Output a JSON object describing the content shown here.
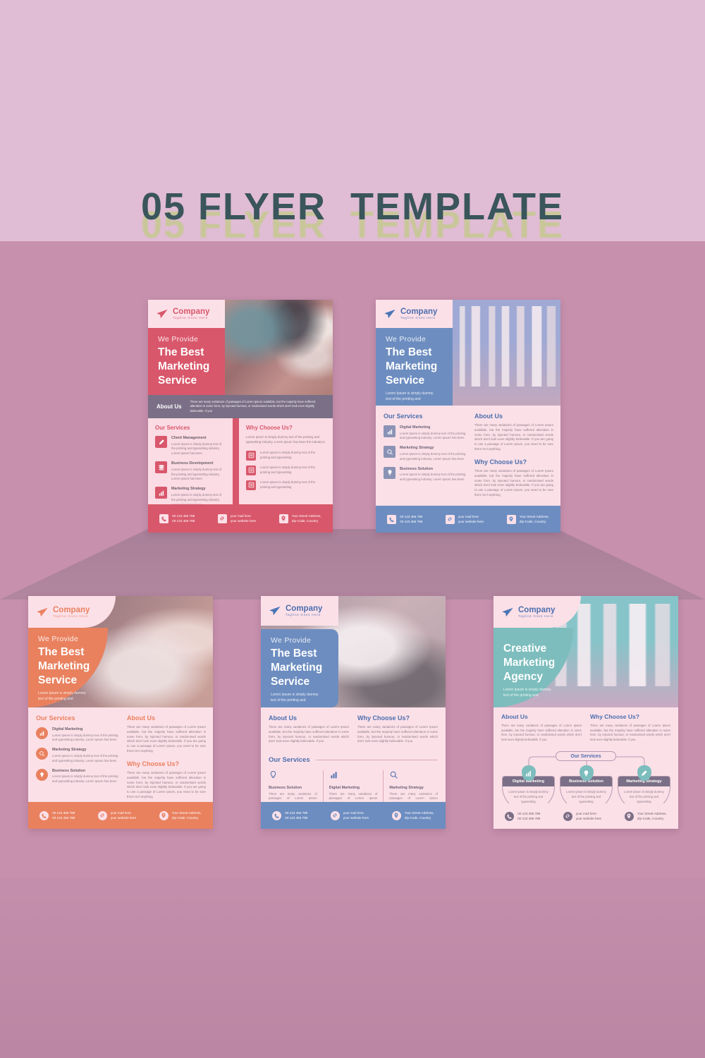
{
  "page": {
    "headline": "05 FLYER  TEMPLATE",
    "bg_top": "#e0bcd5",
    "bg_main": "#c790ad",
    "bg_floor": "#c08aa8",
    "headline_color": "#3a555b",
    "headline_shadow_color": "#c9c79a"
  },
  "brand": {
    "name": "Company",
    "tagline": "Tagline Goes Here",
    "logo_icon": "paper-plane-icon"
  },
  "common": {
    "we_provide": "We Provide",
    "title_line1": "The Best",
    "title_line2": "Marketing",
    "title_line3": "Service",
    "hero_sub_line1": "Lorem Ipsum is simply dummy",
    "hero_sub_line2": "text of the printing and",
    "about_heading": "About Us",
    "services_heading": "Our Services",
    "why_heading": "Why Choose Us?",
    "about_body": "There are many variations of passages of Lorem Ipsum available, but the majority have suffered alteration in some form, by injected humour, or randomised words which don't look even slightly believable. If you are going to use a passage of Lorem Ipsum, you need to be sure there isn't anything",
    "why_body": "There are many variations of passages of Lorem Ipsum available, but the majority have suffered alteration in some form, by injected humour, or randomised words which don't look even slightly believable. If you are going to use a passage of Lorem Ipsum, you need to be sure there isn't anything",
    "short_body": "There are many variations of passages of Lorem Ipsum available, but the majority have suffered alteration in some form, by injected humour, or randomised words which don't look even slightly believable. If you",
    "svc_body": "Lorem Ipsum is simply dummy text of the printing and typesetting industry. Lorem Ipsum has been",
    "mini_body": "There are many variations of passages of Lorem Ipsum available,",
    "card_body": "Lorem Ipsum is simply dummy text of the printing and typesetting",
    "contact": {
      "phone_line1": "00 123 456 789",
      "phone_line2": "00 123 456 789",
      "mail_line1": "your mail here",
      "mail_line2": "your website here",
      "addr_line1": "Your Street Address,",
      "addr_line2": "Zip-Code, Country",
      "phone_icon": "phone-icon",
      "mail_icon": "link-icon",
      "pin_icon": "location-pin-icon"
    }
  },
  "flyers": [
    {
      "id": "flyer-red",
      "accent": "#d9576b",
      "photo": "desk-laptop-coffee-photo",
      "services": [
        {
          "name": "Client Management",
          "icon": "brush-icon"
        },
        {
          "name": "Business Development",
          "icon": "layers-icon"
        },
        {
          "name": "Marketing Strategy",
          "icon": "bar-chart-icon"
        }
      ],
      "why_intro": "Lorem Ipsum is simply dummy text of the printing and typesetting industry. Lorem Ipsum has been the industry's",
      "why_items": [
        {
          "text": "Lorem Ipsum is simply dummy text of the printing and typesetting",
          "icon": "list-icon"
        },
        {
          "text": "Lorem Ipsum is simply dummy text of the printing and typesetting",
          "icon": "list-icon"
        },
        {
          "text": "Lorem Ipsum is simply dummy text of the printing and typesetting",
          "icon": "list-icon"
        }
      ]
    },
    {
      "id": "flyer-blue-top",
      "accent": "#6d8dc0",
      "photo": "city-skyscrapers-photo",
      "services": [
        {
          "name": "Digital Marketing",
          "icon": "bar-chart-icon"
        },
        {
          "name": "Marketing Strategy",
          "icon": "target-search-icon"
        },
        {
          "name": "Business Solution",
          "icon": "lightbulb-icon"
        }
      ]
    },
    {
      "id": "flyer-orange",
      "accent": "#e9815f",
      "photo": "hand-pointing-laptop-photo",
      "services": [
        {
          "name": "Digital Marketing",
          "icon": "bar-chart-icon"
        },
        {
          "name": "Marketing Strategy",
          "icon": "target-search-icon"
        },
        {
          "name": "Business Solution",
          "icon": "lightbulb-icon"
        }
      ]
    },
    {
      "id": "flyer-blue-bottom",
      "accent": "#6d8dc0",
      "photo": "desk-writing-laptop-photo",
      "services": [
        {
          "name": "Business Solution",
          "icon": "lightbulb-icon"
        },
        {
          "name": "Digital Marketing",
          "icon": "bar-chart-icon"
        },
        {
          "name": "Marketing Strategy",
          "icon": "target-search-icon"
        }
      ]
    },
    {
      "id": "flyer-teal",
      "accent": "#7dbdbd",
      "photo": "city-skyscrapers-teal-photo",
      "title_line1": "Creative",
      "title_line2": "Marketing",
      "title_line3": "Agency",
      "services": [
        {
          "name": "Digital Marketing",
          "icon": "bar-chart-icon"
        },
        {
          "name": "Business Solution",
          "icon": "lightbulb-icon"
        },
        {
          "name": "Marketing Strategy",
          "icon": "pen-icon"
        }
      ]
    }
  ]
}
